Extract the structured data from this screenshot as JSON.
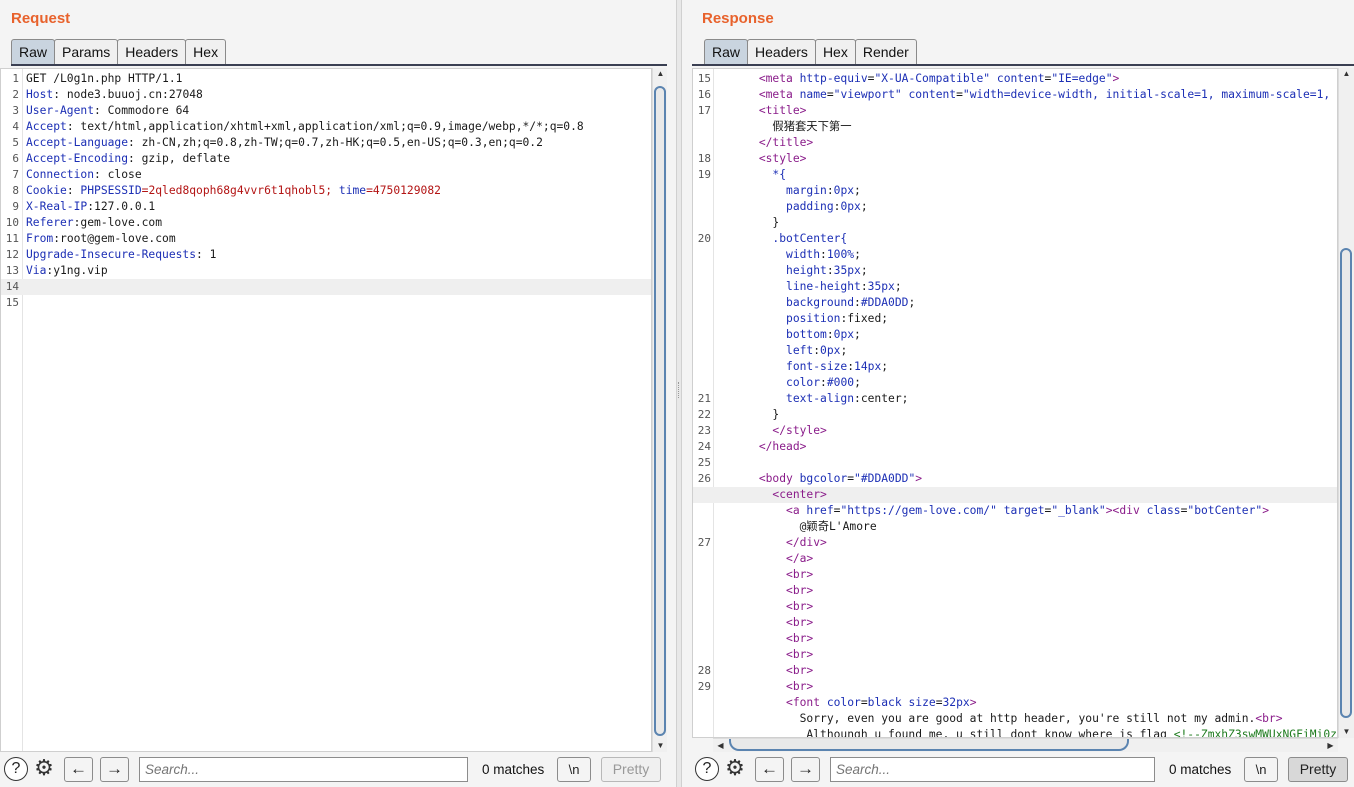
{
  "request": {
    "title": "Request",
    "tabs": [
      "Raw",
      "Params",
      "Headers",
      "Hex"
    ],
    "active_tab": "Raw",
    "line_numbers": [
      "1",
      "2",
      "3",
      "4",
      "5",
      "6",
      "7",
      "8",
      "9",
      "10",
      "11",
      "12",
      "13",
      "14",
      "15"
    ],
    "lines": [
      [
        {
          "t": "GET /L0g1n.php HTTP/1.1",
          "c": ""
        }
      ],
      [
        {
          "t": "Host",
          "c": "k"
        },
        {
          "t": ": node3.buuoj.cn:27048",
          "c": ""
        }
      ],
      [
        {
          "t": "User-Agent",
          "c": "k"
        },
        {
          "t": ": Commodore 64",
          "c": ""
        }
      ],
      [
        {
          "t": "Accept",
          "c": "k"
        },
        {
          "t": ": text/html,application/xhtml+xml,application/xml;q=0.9,image/webp,*/*;q=0.8",
          "c": ""
        }
      ],
      [
        {
          "t": "Accept-Language",
          "c": "k"
        },
        {
          "t": ": zh-CN,zh;q=0.8,zh-TW;q=0.7,zh-HK;q=0.5,en-US;q=0.3,en;q=0.2",
          "c": ""
        }
      ],
      [
        {
          "t": "Accept-Encoding",
          "c": "k"
        },
        {
          "t": ": gzip, deflate",
          "c": ""
        }
      ],
      [
        {
          "t": "Connection",
          "c": "k"
        },
        {
          "t": ": close",
          "c": ""
        }
      ],
      [
        {
          "t": "Cookie",
          "c": "k"
        },
        {
          "t": ": ",
          "c": ""
        },
        {
          "t": "PHPSESSID",
          "c": "k"
        },
        {
          "t": "=2qled8qoph68g4vvr6t1qhobl5; ",
          "c": "v"
        },
        {
          "t": "time",
          "c": "k"
        },
        {
          "t": "=4750129082",
          "c": "v"
        }
      ],
      [
        {
          "t": "X-Real-IP",
          "c": "k"
        },
        {
          "t": ":127.0.0.1",
          "c": ""
        }
      ],
      [
        {
          "t": "Referer",
          "c": "k"
        },
        {
          "t": ":gem-love.com",
          "c": ""
        }
      ],
      [
        {
          "t": "From",
          "c": "k"
        },
        {
          "t": ":root@gem-love.com",
          "c": ""
        }
      ],
      [
        {
          "t": "Upgrade-Insecure-Requests",
          "c": "k"
        },
        {
          "t": ": 1",
          "c": ""
        }
      ],
      [
        {
          "t": "Via",
          "c": "k"
        },
        {
          "t": ":y1ng.vip",
          "c": ""
        }
      ],
      [],
      []
    ],
    "highlight_line": 14,
    "search_placeholder": "Search...",
    "matches": "0 matches",
    "newline_label": "\\n",
    "pretty_label": "Pretty",
    "help_label": "?",
    "back_label": "←",
    "forward_label": "→"
  },
  "response": {
    "title": "Response",
    "tabs": [
      "Raw",
      "Headers",
      "Hex",
      "Render"
    ],
    "active_tab": "Raw",
    "line_numbers": [
      "15",
      "16",
      "17",
      "",
      "",
      "18",
      "19",
      "",
      "",
      "",
      "20",
      "",
      "",
      "",
      "",
      "",
      "",
      "",
      "",
      "",
      "21",
      "22",
      "23",
      "24",
      "25",
      "26",
      "",
      "",
      "",
      "27",
      "",
      "",
      "",
      "",
      "",
      "",
      "",
      "28",
      "29",
      ""
    ],
    "lines": [
      [
        {
          "t": "      ",
          "c": ""
        },
        {
          "t": "<meta ",
          "c": "tg"
        },
        {
          "t": "http-equiv",
          "c": "at"
        },
        {
          "t": "=",
          "c": ""
        },
        {
          "t": "\"X-UA-Compatible\" ",
          "c": "av"
        },
        {
          "t": "content",
          "c": "at"
        },
        {
          "t": "=",
          "c": ""
        },
        {
          "t": "\"IE=edge\"",
          "c": "av"
        },
        {
          "t": ">",
          "c": "tg"
        }
      ],
      [
        {
          "t": "      ",
          "c": ""
        },
        {
          "t": "<meta ",
          "c": "tg"
        },
        {
          "t": "name",
          "c": "at"
        },
        {
          "t": "=",
          "c": ""
        },
        {
          "t": "\"viewport\" ",
          "c": "av"
        },
        {
          "t": "content",
          "c": "at"
        },
        {
          "t": "=",
          "c": ""
        },
        {
          "t": "\"width=device-width, initial-scale=1, maximum-scale=1,",
          "c": "av"
        }
      ],
      [
        {
          "t": "      ",
          "c": ""
        },
        {
          "t": "<title>",
          "c": "tg"
        }
      ],
      [
        {
          "t": "        假猪套天下第一",
          "c": ""
        }
      ],
      [
        {
          "t": "      ",
          "c": ""
        },
        {
          "t": "</title>",
          "c": "tg"
        }
      ],
      [
        {
          "t": "      ",
          "c": ""
        },
        {
          "t": "<style>",
          "c": "tg"
        }
      ],
      [
        {
          "t": "        ",
          "c": ""
        },
        {
          "t": "*{",
          "c": "pp"
        }
      ],
      [
        {
          "t": "          ",
          "c": ""
        },
        {
          "t": "margin",
          "c": "pp"
        },
        {
          "t": ":",
          "c": ""
        },
        {
          "t": "0px",
          "c": "pp"
        },
        {
          "t": ";",
          "c": ""
        }
      ],
      [
        {
          "t": "          ",
          "c": ""
        },
        {
          "t": "padding",
          "c": "pp"
        },
        {
          "t": ":",
          "c": ""
        },
        {
          "t": "0px",
          "c": "pp"
        },
        {
          "t": ";",
          "c": ""
        }
      ],
      [
        {
          "t": "        }",
          "c": ""
        }
      ],
      [
        {
          "t": "        ",
          "c": ""
        },
        {
          "t": ".botCenter{",
          "c": "pp"
        }
      ],
      [
        {
          "t": "          ",
          "c": ""
        },
        {
          "t": "width",
          "c": "pp"
        },
        {
          "t": ":",
          "c": ""
        },
        {
          "t": "100%",
          "c": "pp"
        },
        {
          "t": ";",
          "c": ""
        }
      ],
      [
        {
          "t": "          ",
          "c": ""
        },
        {
          "t": "height",
          "c": "pp"
        },
        {
          "t": ":",
          "c": ""
        },
        {
          "t": "35px",
          "c": "pp"
        },
        {
          "t": ";",
          "c": ""
        }
      ],
      [
        {
          "t": "          ",
          "c": ""
        },
        {
          "t": "line-height",
          "c": "pp"
        },
        {
          "t": ":",
          "c": ""
        },
        {
          "t": "35px",
          "c": "pp"
        },
        {
          "t": ";",
          "c": ""
        }
      ],
      [
        {
          "t": "          ",
          "c": ""
        },
        {
          "t": "background",
          "c": "pp"
        },
        {
          "t": ":",
          "c": ""
        },
        {
          "t": "#DDA0DD",
          "c": "pp"
        },
        {
          "t": ";",
          "c": ""
        }
      ],
      [
        {
          "t": "          ",
          "c": ""
        },
        {
          "t": "position",
          "c": "pp"
        },
        {
          "t": ":fixed;",
          "c": ""
        }
      ],
      [
        {
          "t": "          ",
          "c": ""
        },
        {
          "t": "bottom",
          "c": "pp"
        },
        {
          "t": ":",
          "c": ""
        },
        {
          "t": "0px",
          "c": "pp"
        },
        {
          "t": ";",
          "c": ""
        }
      ],
      [
        {
          "t": "          ",
          "c": ""
        },
        {
          "t": "left",
          "c": "pp"
        },
        {
          "t": ":",
          "c": ""
        },
        {
          "t": "0px",
          "c": "pp"
        },
        {
          "t": ";",
          "c": ""
        }
      ],
      [
        {
          "t": "          ",
          "c": ""
        },
        {
          "t": "font-size",
          "c": "pp"
        },
        {
          "t": ":",
          "c": ""
        },
        {
          "t": "14px",
          "c": "pp"
        },
        {
          "t": ";",
          "c": ""
        }
      ],
      [
        {
          "t": "          ",
          "c": ""
        },
        {
          "t": "color",
          "c": "pp"
        },
        {
          "t": ":",
          "c": ""
        },
        {
          "t": "#000",
          "c": "pp"
        },
        {
          "t": ";",
          "c": ""
        }
      ],
      [
        {
          "t": "          ",
          "c": ""
        },
        {
          "t": "text-align",
          "c": "pp"
        },
        {
          "t": ":center;",
          "c": ""
        }
      ],
      [
        {
          "t": "        }",
          "c": ""
        }
      ],
      [
        {
          "t": "        ",
          "c": ""
        },
        {
          "t": "</style>",
          "c": "tg"
        }
      ],
      [
        {
          "t": "      ",
          "c": ""
        },
        {
          "t": "</head>",
          "c": "tg"
        }
      ],
      [],
      [
        {
          "t": "      ",
          "c": ""
        },
        {
          "t": "<body ",
          "c": "tg"
        },
        {
          "t": "bgcolor",
          "c": "at"
        },
        {
          "t": "=",
          "c": ""
        },
        {
          "t": "\"#DDA0DD\"",
          "c": "av"
        },
        {
          "t": ">",
          "c": "tg"
        }
      ],
      [
        {
          "t": "        ",
          "c": ""
        },
        {
          "t": "<center>",
          "c": "tg"
        }
      ],
      [
        {
          "t": "          ",
          "c": ""
        },
        {
          "t": "<a ",
          "c": "tg"
        },
        {
          "t": "href",
          "c": "at"
        },
        {
          "t": "=",
          "c": ""
        },
        {
          "t": "\"https://gem-love.com/\" ",
          "c": "av"
        },
        {
          "t": "target",
          "c": "at"
        },
        {
          "t": "=",
          "c": ""
        },
        {
          "t": "\"_blank\"",
          "c": "av"
        },
        {
          "t": ">",
          "c": "tg"
        },
        {
          "t": "<div ",
          "c": "tg"
        },
        {
          "t": "class",
          "c": "at"
        },
        {
          "t": "=",
          "c": ""
        },
        {
          "t": "\"botCenter\"",
          "c": "av"
        },
        {
          "t": ">",
          "c": "tg"
        }
      ],
      [
        {
          "t": "            @颖奇L'Amore",
          "c": ""
        }
      ],
      [
        {
          "t": "          ",
          "c": ""
        },
        {
          "t": "</div>",
          "c": "tg"
        }
      ],
      [
        {
          "t": "          ",
          "c": ""
        },
        {
          "t": "</a>",
          "c": "tg"
        }
      ],
      [
        {
          "t": "          ",
          "c": ""
        },
        {
          "t": "<br>",
          "c": "tg"
        }
      ],
      [
        {
          "t": "          ",
          "c": ""
        },
        {
          "t": "<br>",
          "c": "tg"
        }
      ],
      [
        {
          "t": "          ",
          "c": ""
        },
        {
          "t": "<br>",
          "c": "tg"
        }
      ],
      [
        {
          "t": "          ",
          "c": ""
        },
        {
          "t": "<br>",
          "c": "tg"
        }
      ],
      [
        {
          "t": "          ",
          "c": ""
        },
        {
          "t": "<br>",
          "c": "tg"
        }
      ],
      [
        {
          "t": "          ",
          "c": ""
        },
        {
          "t": "<br>",
          "c": "tg"
        }
      ],
      [
        {
          "t": "          ",
          "c": ""
        },
        {
          "t": "<br>",
          "c": "tg"
        }
      ],
      [
        {
          "t": "          ",
          "c": ""
        },
        {
          "t": "<br>",
          "c": "tg"
        }
      ],
      [
        {
          "t": "          ",
          "c": ""
        },
        {
          "t": "<font ",
          "c": "tg"
        },
        {
          "t": "color",
          "c": "at"
        },
        {
          "t": "=",
          "c": ""
        },
        {
          "t": "black ",
          "c": "av"
        },
        {
          "t": "size",
          "c": "at"
        },
        {
          "t": "=",
          "c": ""
        },
        {
          "t": "32px",
          "c": "av"
        },
        {
          "t": ">",
          "c": "tg"
        }
      ],
      [
        {
          "t": "            Sorry, even you are good at http header, you're still not my admin.",
          "c": ""
        },
        {
          "t": "<br>",
          "c": "tg"
        }
      ],
      [
        {
          "t": "             Althoungh u found me, u still dont know where is flag ",
          "c": ""
        },
        {
          "t": "<!--ZmxhZ3swMWUxNGFiMi0z",
          "c": "cm"
        }
      ]
    ],
    "highlight_line": 27,
    "search_placeholder": "Search...",
    "matches": "0 matches",
    "newline_label": "\\n",
    "pretty_label": "Pretty",
    "help_label": "?",
    "back_label": "←",
    "forward_label": "→"
  },
  "icons": [
    "help-icon",
    "settings-gear-icon",
    "back-arrow-icon",
    "forward-arrow-icon"
  ]
}
